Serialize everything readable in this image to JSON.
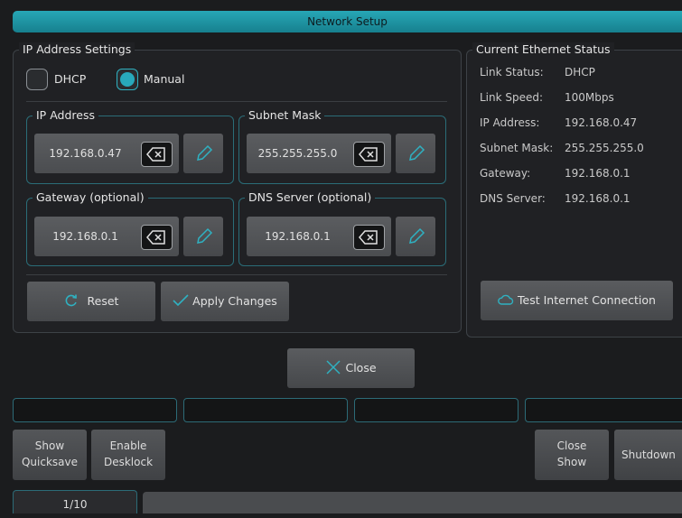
{
  "window": {
    "title": "Network Setup"
  },
  "ip_settings": {
    "title": "IP Address Settings",
    "modes": [
      {
        "label": "DHCP",
        "selected": false
      },
      {
        "label": "Manual",
        "selected": true
      }
    ],
    "fields": [
      {
        "title": "IP Address",
        "value": "192.168.0.47"
      },
      {
        "title": "Subnet Mask",
        "value": "255.255.255.0"
      },
      {
        "title": "Gateway (optional)",
        "value": "192.168.0.1"
      },
      {
        "title": "DNS Server (optional)",
        "value": "192.168.0.1"
      }
    ],
    "reset_label": "Reset",
    "apply_label": "Apply Changes"
  },
  "status": {
    "title": "Current Ethernet Status",
    "rows": [
      {
        "label": "Link Status:",
        "value": "DHCP"
      },
      {
        "label": "Link Speed:",
        "value": "100Mbps"
      },
      {
        "label": "IP Address:",
        "value": "192.168.0.47"
      },
      {
        "label": "Subnet Mask:",
        "value": "255.255.255.0"
      },
      {
        "label": "Gateway:",
        "value": "192.168.0.1"
      },
      {
        "label": "DNS Server:",
        "value": "192.168.0.1"
      }
    ],
    "test_label": "Test Internet Connection"
  },
  "close_label": "Close",
  "footer": {
    "buttons": [
      {
        "line1": "Show",
        "line2": "Quicksave"
      },
      {
        "line1": "Enable",
        "line2": "Desklock"
      },
      {
        "line1": "Close",
        "line2": "Show"
      },
      {
        "line1": "Shutdown",
        "line2": ""
      }
    ],
    "page_indicator": "1/10"
  },
  "colors": {
    "accent": "#28a9bb",
    "panel": "#202124",
    "background": "#1b1c1e"
  },
  "icons": {
    "clear": "backspace-icon",
    "edit": "pencil-icon",
    "reset": "refresh-icon",
    "apply": "checkmark-icon",
    "test": "cloud-icon",
    "close": "x-icon"
  }
}
